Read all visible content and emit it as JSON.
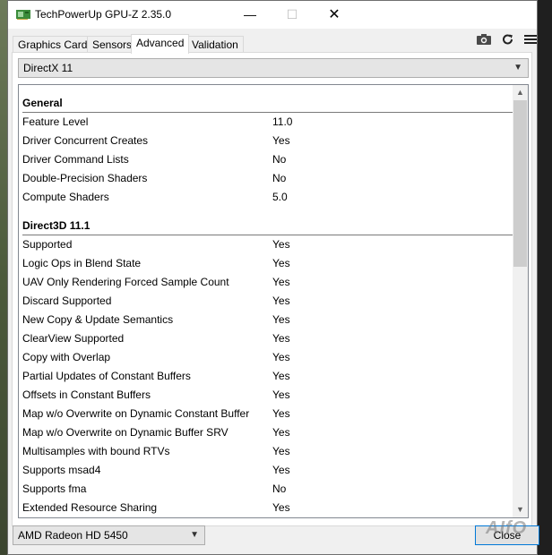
{
  "window": {
    "title": "TechPowerUp GPU-Z 2.35.0",
    "minimize": "—",
    "maximize": "☐",
    "close": "✕"
  },
  "tabs": [
    {
      "label": "Graphics Card",
      "active": false
    },
    {
      "label": "Sensors",
      "active": false
    },
    {
      "label": "Advanced",
      "active": true
    },
    {
      "label": "Validation",
      "active": false
    }
  ],
  "toolbar": {
    "camera": "camera-icon",
    "refresh": "refresh-icon",
    "menu": "menu-icon"
  },
  "category_select": {
    "value": "DirectX 11"
  },
  "general": {
    "heading": "General",
    "rows": [
      {
        "key": "Feature Level",
        "value": "11.0"
      },
      {
        "key": "Driver Concurrent Creates",
        "value": "Yes"
      },
      {
        "key": "Driver Command Lists",
        "value": "No"
      },
      {
        "key": "Double-Precision Shaders",
        "value": "No"
      },
      {
        "key": "Compute Shaders",
        "value": "5.0"
      }
    ]
  },
  "d3d111": {
    "heading": "Direct3D 11.1",
    "rows": [
      {
        "key": "Supported",
        "value": "Yes"
      },
      {
        "key": "Logic Ops in Blend State",
        "value": "Yes"
      },
      {
        "key": "UAV Only Rendering Forced Sample Count",
        "value": "Yes"
      },
      {
        "key": "Discard Supported",
        "value": "Yes"
      },
      {
        "key": "New Copy & Update Semantics",
        "value": "Yes"
      },
      {
        "key": "ClearView Supported",
        "value": "Yes"
      },
      {
        "key": "Copy with Overlap",
        "value": "Yes"
      },
      {
        "key": "Partial Updates of Constant Buffers",
        "value": "Yes"
      },
      {
        "key": "Offsets in Constant Buffers",
        "value": "Yes"
      },
      {
        "key": "Map w/o Overwrite on Dynamic Constant Buffer",
        "value": "Yes"
      },
      {
        "key": "Map w/o Overwrite on Dynamic Buffer SRV",
        "value": "Yes"
      },
      {
        "key": "Multisamples with bound RTVs",
        "value": "Yes"
      },
      {
        "key": "Supports msad4",
        "value": "Yes"
      },
      {
        "key": "Supports fma",
        "value": "No"
      },
      {
        "key": "Extended Resource Sharing",
        "value": "Yes"
      }
    ]
  },
  "gpu_select": {
    "value": "AMD Radeon HD 5450"
  },
  "close_button": {
    "label": "Close"
  },
  "watermark": "AIfO",
  "colors": {
    "accent": "#0078d7"
  }
}
